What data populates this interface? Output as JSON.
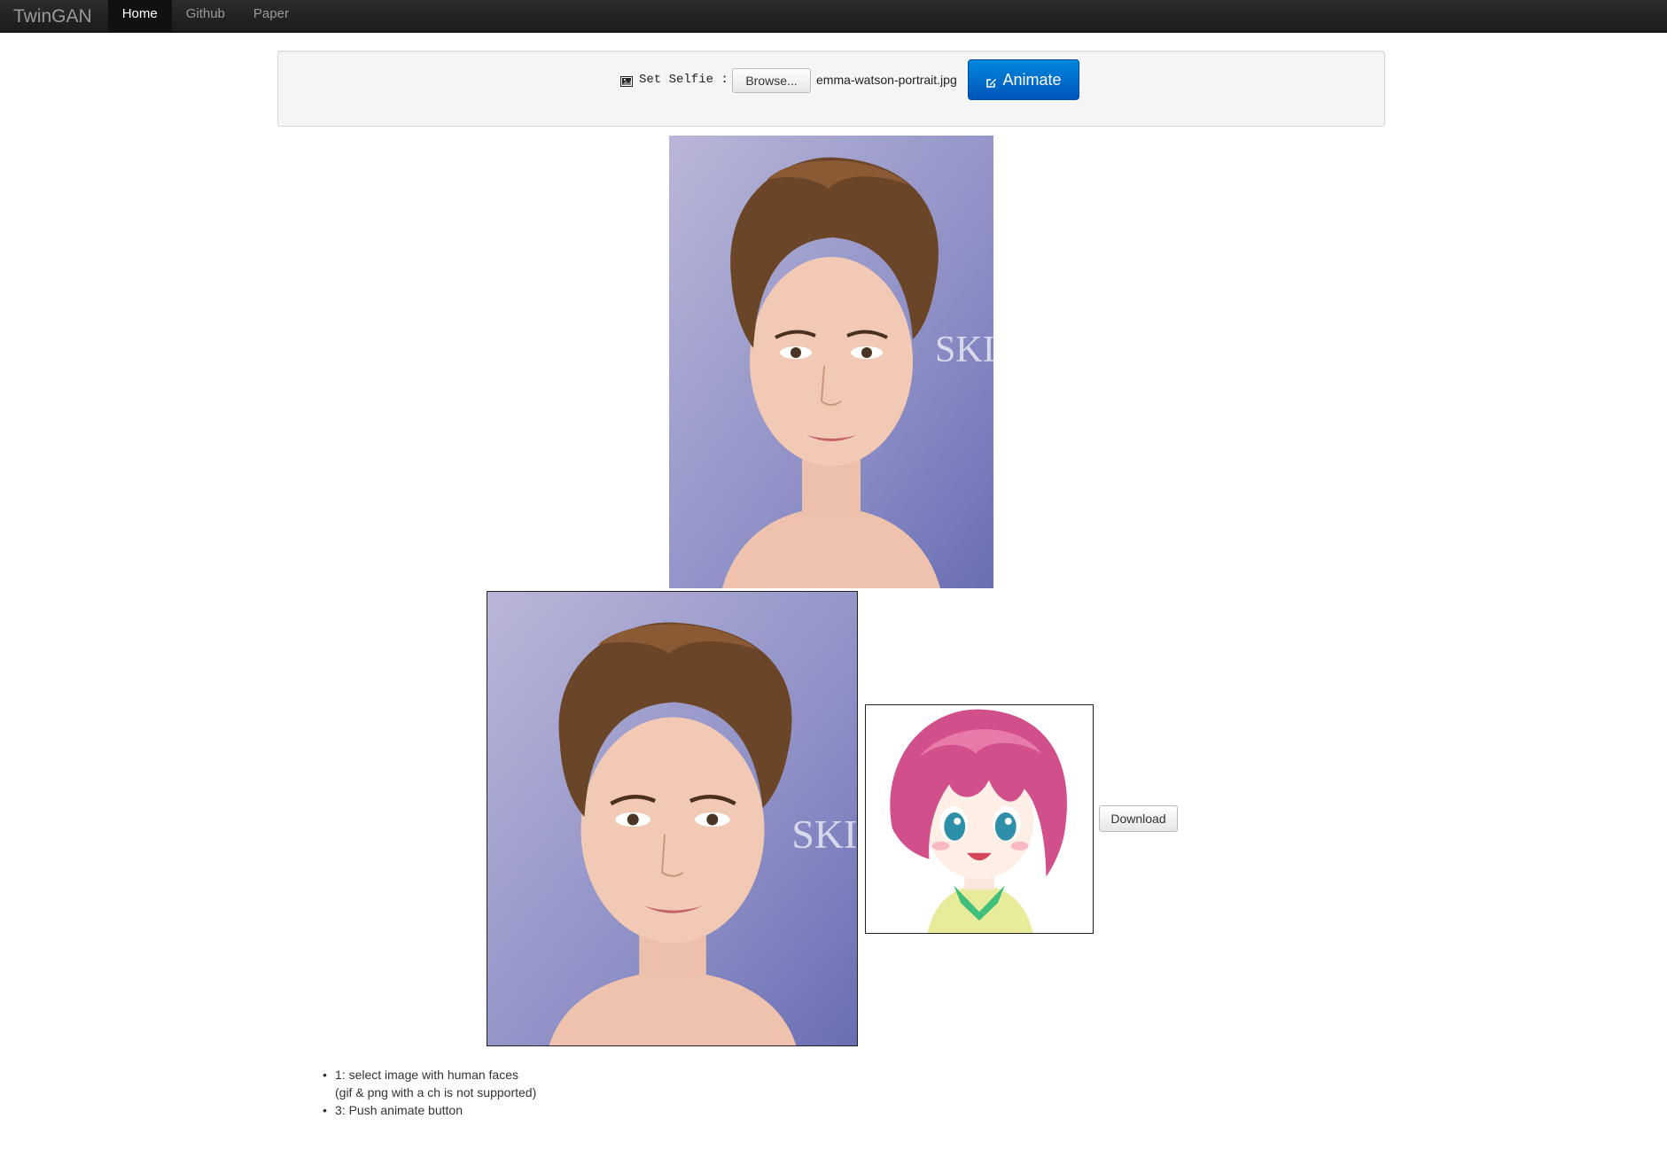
{
  "navbar": {
    "brand": "TwinGAN",
    "items": [
      {
        "label": "Home",
        "active": true
      },
      {
        "label": "Github",
        "active": false
      },
      {
        "label": "Paper",
        "active": false
      }
    ]
  },
  "upload": {
    "icon": "picture-icon",
    "label": "Set Selfie :",
    "browse_label": "Browse...",
    "file_name": "emma-watson-portrait.jpg",
    "animate_icon": "edit-icon",
    "animate_label": "Animate",
    "animate_color": "#0066cc"
  },
  "result": {
    "download_label": "Download"
  },
  "instructions": [
    {
      "text": "1: select image with human faces",
      "bullet": true
    },
    {
      "text": "(gif & png with a ch is not supported)",
      "bullet": false
    },
    {
      "text": "3: Push animate button",
      "bullet": true
    }
  ]
}
